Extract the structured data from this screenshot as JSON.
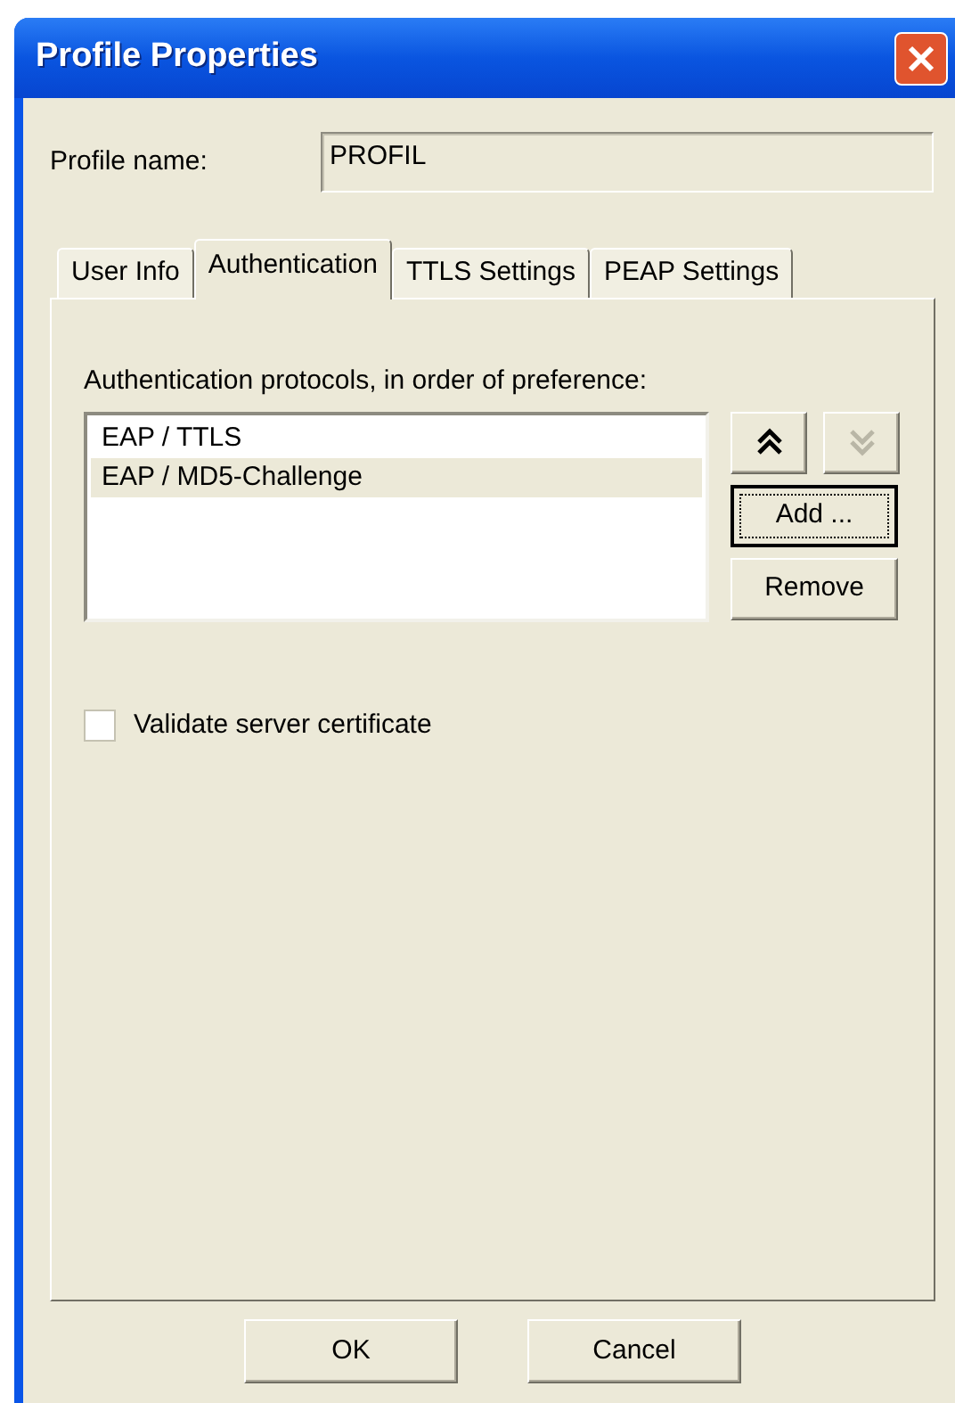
{
  "window": {
    "title": "Profile Properties"
  },
  "profile_name": {
    "label": "Profile name:",
    "value": "PROFIL"
  },
  "tabs": [
    {
      "label": "User Info",
      "selected": false
    },
    {
      "label": "Authentication",
      "selected": true
    },
    {
      "label": "TTLS Settings",
      "selected": false
    },
    {
      "label": "PEAP Settings",
      "selected": false
    }
  ],
  "protocols": {
    "label": "Authentication protocols, in order of preference:",
    "items": [
      {
        "label": "EAP / TTLS",
        "selected": false
      },
      {
        "label": "EAP / MD5-Challenge",
        "selected": true
      }
    ],
    "move_up": {
      "disabled": false
    },
    "move_down": {
      "disabled": true
    },
    "buttons": [
      {
        "label": "Add ...",
        "focused": true
      },
      {
        "label": "Remove",
        "focused": false
      }
    ]
  },
  "validate_certificate": {
    "label": "Validate server certificate",
    "checked": false
  },
  "footer_buttons": [
    "OK",
    "Cancel"
  ]
}
